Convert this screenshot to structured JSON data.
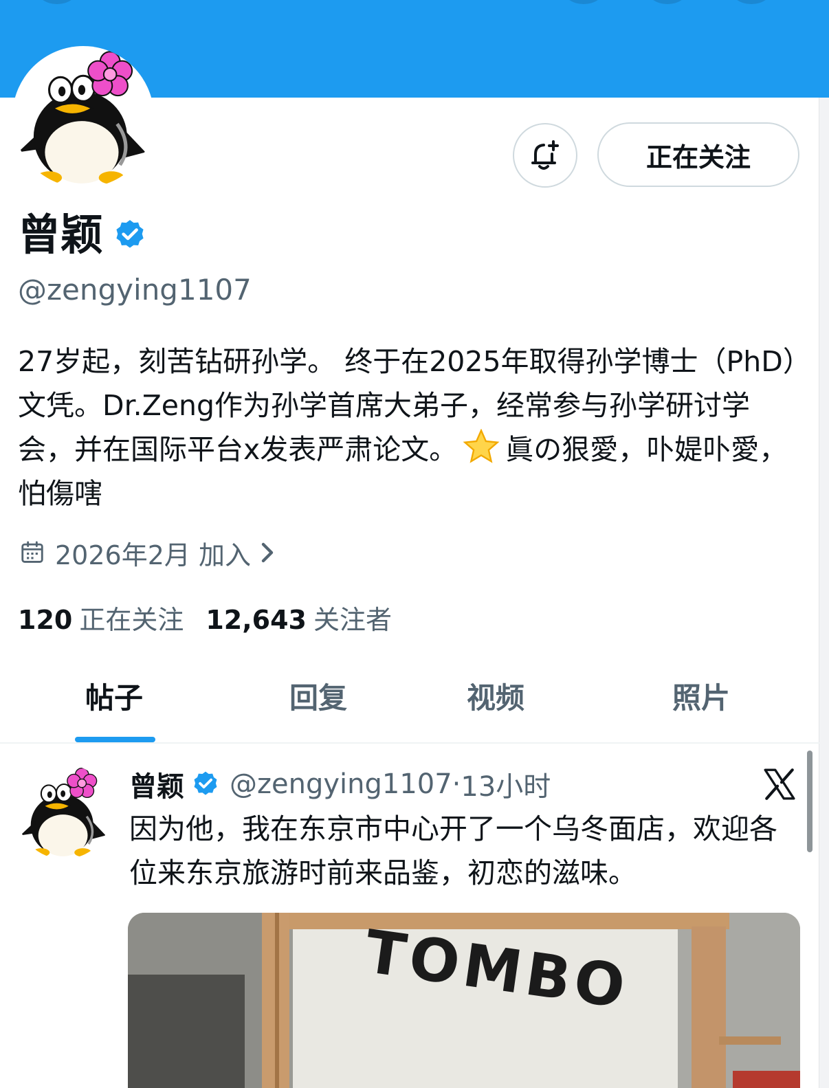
{
  "profile": {
    "name": "曾颖",
    "handle": "@zengying1107",
    "bio_main": "27岁起，刻苦钻研孙学。 终于在2025年取得孙学博士（PhD）文凭。Dr.Zeng作为孙学首席大弟子，经常参与孙学研讨学会，并在国际平台x发表严肃论文。",
    "bio_emoji": "star-emoji",
    "bio_tail": "眞の狠愛，卟媞卟愛，怕傷嗐",
    "joined": "2026年2月 加入",
    "following_count": "120",
    "following_label": "正在关注",
    "followers_count": "12,643",
    "followers_label": "关注者"
  },
  "actions": {
    "follow_label": "正在关注",
    "notify_icon": "bell-plus-icon"
  },
  "tabs": [
    {
      "label": "帖子",
      "active": true
    },
    {
      "label": "回复",
      "active": false
    },
    {
      "label": "视频",
      "active": false
    },
    {
      "label": "照片",
      "active": false
    }
  ],
  "post": {
    "name": "曾颖",
    "handle": "@zengying1107",
    "time": "13小时",
    "text": "因为他，我在东京市中心开了一个乌冬面店，欢迎各位来东京旅游时前来品鉴，初恋的滋味。",
    "image_sign": "TOMBO"
  },
  "colors": {
    "accent": "#1d9bf0",
    "verified": "#1d9bf0",
    "muted": "#536471"
  }
}
